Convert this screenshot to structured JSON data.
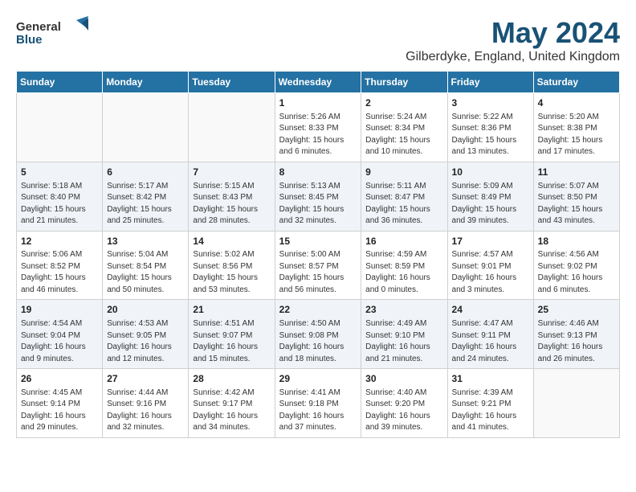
{
  "logo": {
    "general": "General",
    "blue": "Blue"
  },
  "title": {
    "month": "May 2024",
    "location": "Gilberdyke, England, United Kingdom"
  },
  "weekdays": [
    "Sunday",
    "Monday",
    "Tuesday",
    "Wednesday",
    "Thursday",
    "Friday",
    "Saturday"
  ],
  "weeks": [
    [
      {
        "day": "",
        "info": ""
      },
      {
        "day": "",
        "info": ""
      },
      {
        "day": "",
        "info": ""
      },
      {
        "day": "1",
        "info": "Sunrise: 5:26 AM\nSunset: 8:33 PM\nDaylight: 15 hours\nand 6 minutes."
      },
      {
        "day": "2",
        "info": "Sunrise: 5:24 AM\nSunset: 8:34 PM\nDaylight: 15 hours\nand 10 minutes."
      },
      {
        "day": "3",
        "info": "Sunrise: 5:22 AM\nSunset: 8:36 PM\nDaylight: 15 hours\nand 13 minutes."
      },
      {
        "day": "4",
        "info": "Sunrise: 5:20 AM\nSunset: 8:38 PM\nDaylight: 15 hours\nand 17 minutes."
      }
    ],
    [
      {
        "day": "5",
        "info": "Sunrise: 5:18 AM\nSunset: 8:40 PM\nDaylight: 15 hours\nand 21 minutes."
      },
      {
        "day": "6",
        "info": "Sunrise: 5:17 AM\nSunset: 8:42 PM\nDaylight: 15 hours\nand 25 minutes."
      },
      {
        "day": "7",
        "info": "Sunrise: 5:15 AM\nSunset: 8:43 PM\nDaylight: 15 hours\nand 28 minutes."
      },
      {
        "day": "8",
        "info": "Sunrise: 5:13 AM\nSunset: 8:45 PM\nDaylight: 15 hours\nand 32 minutes."
      },
      {
        "day": "9",
        "info": "Sunrise: 5:11 AM\nSunset: 8:47 PM\nDaylight: 15 hours\nand 36 minutes."
      },
      {
        "day": "10",
        "info": "Sunrise: 5:09 AM\nSunset: 8:49 PM\nDaylight: 15 hours\nand 39 minutes."
      },
      {
        "day": "11",
        "info": "Sunrise: 5:07 AM\nSunset: 8:50 PM\nDaylight: 15 hours\nand 43 minutes."
      }
    ],
    [
      {
        "day": "12",
        "info": "Sunrise: 5:06 AM\nSunset: 8:52 PM\nDaylight: 15 hours\nand 46 minutes."
      },
      {
        "day": "13",
        "info": "Sunrise: 5:04 AM\nSunset: 8:54 PM\nDaylight: 15 hours\nand 50 minutes."
      },
      {
        "day": "14",
        "info": "Sunrise: 5:02 AM\nSunset: 8:56 PM\nDaylight: 15 hours\nand 53 minutes."
      },
      {
        "day": "15",
        "info": "Sunrise: 5:00 AM\nSunset: 8:57 PM\nDaylight: 15 hours\nand 56 minutes."
      },
      {
        "day": "16",
        "info": "Sunrise: 4:59 AM\nSunset: 8:59 PM\nDaylight: 16 hours\nand 0 minutes."
      },
      {
        "day": "17",
        "info": "Sunrise: 4:57 AM\nSunset: 9:01 PM\nDaylight: 16 hours\nand 3 minutes."
      },
      {
        "day": "18",
        "info": "Sunrise: 4:56 AM\nSunset: 9:02 PM\nDaylight: 16 hours\nand 6 minutes."
      }
    ],
    [
      {
        "day": "19",
        "info": "Sunrise: 4:54 AM\nSunset: 9:04 PM\nDaylight: 16 hours\nand 9 minutes."
      },
      {
        "day": "20",
        "info": "Sunrise: 4:53 AM\nSunset: 9:05 PM\nDaylight: 16 hours\nand 12 minutes."
      },
      {
        "day": "21",
        "info": "Sunrise: 4:51 AM\nSunset: 9:07 PM\nDaylight: 16 hours\nand 15 minutes."
      },
      {
        "day": "22",
        "info": "Sunrise: 4:50 AM\nSunset: 9:08 PM\nDaylight: 16 hours\nand 18 minutes."
      },
      {
        "day": "23",
        "info": "Sunrise: 4:49 AM\nSunset: 9:10 PM\nDaylight: 16 hours\nand 21 minutes."
      },
      {
        "day": "24",
        "info": "Sunrise: 4:47 AM\nSunset: 9:11 PM\nDaylight: 16 hours\nand 24 minutes."
      },
      {
        "day": "25",
        "info": "Sunrise: 4:46 AM\nSunset: 9:13 PM\nDaylight: 16 hours\nand 26 minutes."
      }
    ],
    [
      {
        "day": "26",
        "info": "Sunrise: 4:45 AM\nSunset: 9:14 PM\nDaylight: 16 hours\nand 29 minutes."
      },
      {
        "day": "27",
        "info": "Sunrise: 4:44 AM\nSunset: 9:16 PM\nDaylight: 16 hours\nand 32 minutes."
      },
      {
        "day": "28",
        "info": "Sunrise: 4:42 AM\nSunset: 9:17 PM\nDaylight: 16 hours\nand 34 minutes."
      },
      {
        "day": "29",
        "info": "Sunrise: 4:41 AM\nSunset: 9:18 PM\nDaylight: 16 hours\nand 37 minutes."
      },
      {
        "day": "30",
        "info": "Sunrise: 4:40 AM\nSunset: 9:20 PM\nDaylight: 16 hours\nand 39 minutes."
      },
      {
        "day": "31",
        "info": "Sunrise: 4:39 AM\nSunset: 9:21 PM\nDaylight: 16 hours\nand 41 minutes."
      },
      {
        "day": "",
        "info": ""
      }
    ]
  ]
}
